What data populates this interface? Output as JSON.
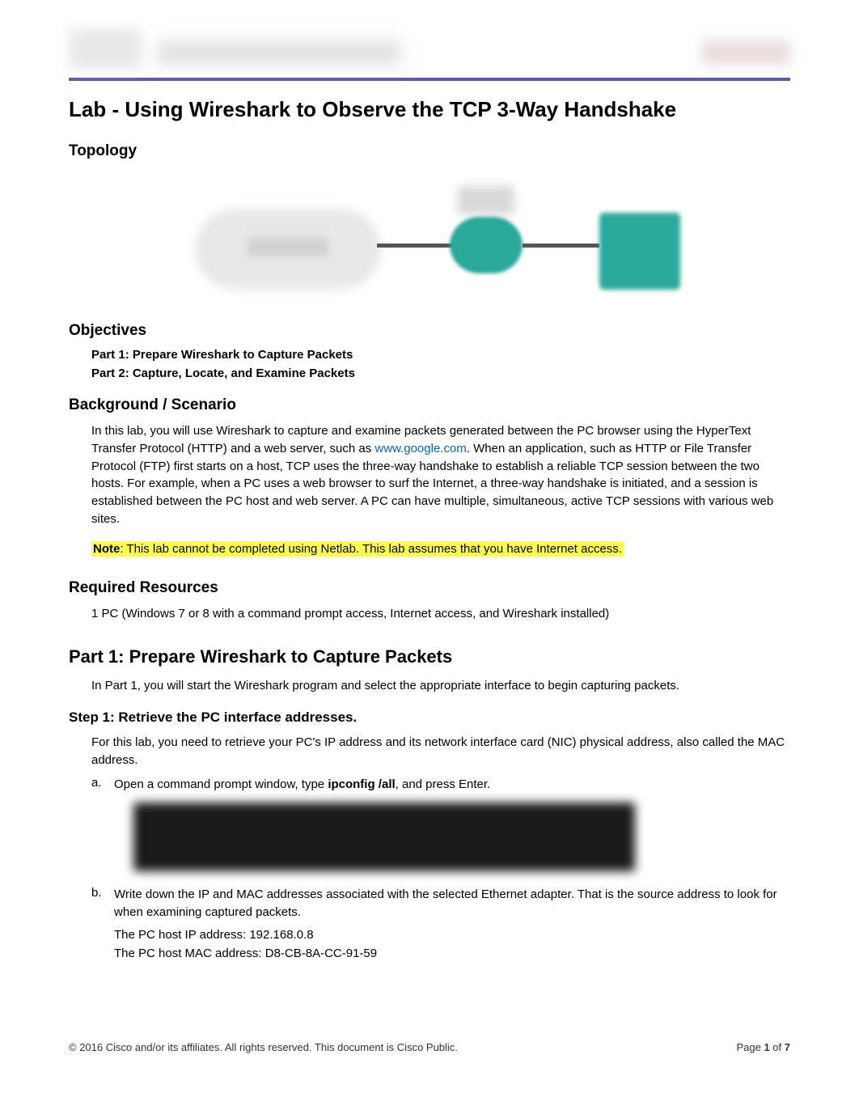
{
  "doc_title": "Lab - Using Wireshark to Observe the TCP 3-Way Handshake",
  "topology": {
    "heading": "Topology"
  },
  "objectives": {
    "heading": "Objectives",
    "items": [
      "Part 1: Prepare Wireshark to Capture Packets",
      "Part 2: Capture, Locate, and Examine Packets"
    ]
  },
  "background": {
    "heading": "Background / Scenario",
    "para_pre": "In this lab, you will use Wireshark to capture and examine packets generated between the PC browser using the HyperText Transfer Protocol (HTTP) and a web server, such as ",
    "link_text": "www.google.com",
    "para_post": ". When an application, such as HTTP or File Transfer Protocol (FTP) first starts on a host, TCP uses the three-way handshake to establish a reliable TCP session between the two hosts. For example, when a PC uses a web browser to surf the Internet, a three-way handshake is initiated, and a session is established between the PC host and web server. A PC can have multiple, simultaneous, active TCP sessions with various web sites.",
    "note_label": "Note",
    "note_text": ": This lab cannot be completed using Netlab. This lab assumes that you have Internet access."
  },
  "resources": {
    "heading": "Required Resources",
    "text": "1 PC (Windows 7 or 8 with a command prompt access, Internet access, and Wireshark installed)"
  },
  "part1": {
    "heading": "Part 1:   Prepare Wireshark to Capture Packets",
    "intro": "In Part 1, you will start the Wireshark program and select the appropriate interface to begin capturing packets."
  },
  "step1": {
    "heading": "Step 1:   Retrieve the PC interface addresses.",
    "intro": "For this lab, you need to retrieve your PC's IP address and its network interface card (NIC) physical address, also called the MAC address.",
    "item_a_marker": "a.",
    "item_a_pre": "Open a command prompt window, type ",
    "item_a_cmd": "ipconfig /all",
    "item_a_post": ", and press Enter.",
    "item_b_marker": "b.",
    "item_b_text": "Write down the IP and MAC addresses associated with the selected Ethernet adapter. That is the source address to look for when examining captured packets.",
    "ip_label": "The PC host IP address: ",
    "ip_value": "192.168.0.8",
    "mac_label": "The PC host MAC address: ",
    "mac_value": "D8-CB-8A-CC-91-59"
  },
  "footer": {
    "copyright": "© 2016 Cisco and/or its affiliates. All rights reserved. This document is Cisco Public.",
    "page_pre": "Page ",
    "page_current": "1",
    "page_mid": " of ",
    "page_total": "7"
  }
}
